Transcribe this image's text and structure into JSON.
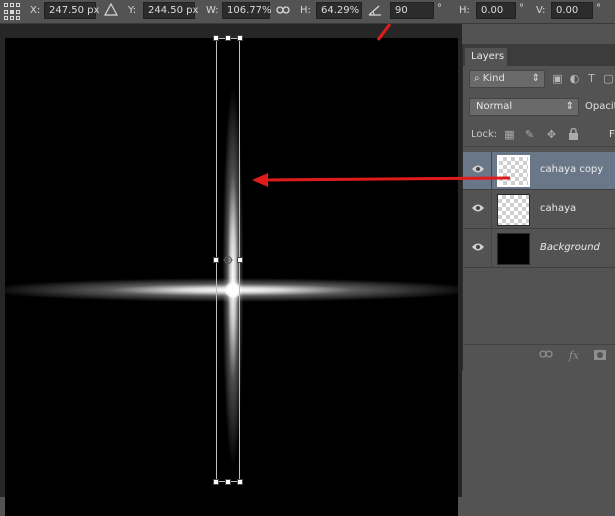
{
  "options_bar": {
    "x_label": "X:",
    "x_value": "247.50 px",
    "y_label": "Y:",
    "y_value": "244.50 px",
    "w_label": "W:",
    "w_value": "106.77%",
    "h_label": "H:",
    "h_value": "64.29%",
    "angle_value": "90",
    "angle_unit": "°",
    "hskew_label": "H:",
    "hskew_value": "0.00",
    "hskew_unit": "°",
    "vskew_label": "V:",
    "vskew_value": "0.00",
    "vskew_unit": "°"
  },
  "layers_panel": {
    "tab_label": "Layers",
    "kind_label": "Kind",
    "blend_mode": "Normal",
    "opacity_label": "Opacity",
    "lock_label": "Lock:",
    "fill_label": "Fi",
    "layers": [
      {
        "name": "cahaya copy",
        "selected": true,
        "thumbnail": "transparent"
      },
      {
        "name": "cahaya",
        "selected": false,
        "thumbnail": "transparent"
      },
      {
        "name": "Background",
        "selected": false,
        "thumbnail": "black",
        "italic": true
      }
    ]
  },
  "annotation_color": "#e01b1b",
  "icons": {
    "reference_point": "reference-point-grid-icon",
    "delta": "delta-triangle-icon",
    "link": "link-icon",
    "angle": "angle-icon",
    "search": "search-icon",
    "eye": "eye-icon",
    "lock": "lock-icon",
    "fx": "fx-icon"
  }
}
